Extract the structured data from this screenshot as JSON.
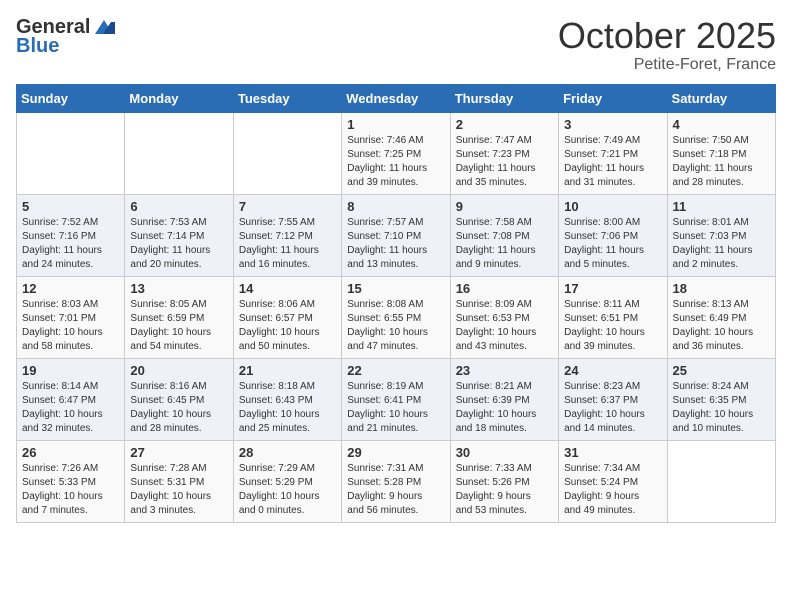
{
  "logo": {
    "general": "General",
    "blue": "Blue"
  },
  "title": "October 2025",
  "location": "Petite-Foret, France",
  "days_of_week": [
    "Sunday",
    "Monday",
    "Tuesday",
    "Wednesday",
    "Thursday",
    "Friday",
    "Saturday"
  ],
  "weeks": [
    [
      {
        "day": "",
        "content": ""
      },
      {
        "day": "",
        "content": ""
      },
      {
        "day": "",
        "content": ""
      },
      {
        "day": "1",
        "content": "Sunrise: 7:46 AM\nSunset: 7:25 PM\nDaylight: 11 hours\nand 39 minutes."
      },
      {
        "day": "2",
        "content": "Sunrise: 7:47 AM\nSunset: 7:23 PM\nDaylight: 11 hours\nand 35 minutes."
      },
      {
        "day": "3",
        "content": "Sunrise: 7:49 AM\nSunset: 7:21 PM\nDaylight: 11 hours\nand 31 minutes."
      },
      {
        "day": "4",
        "content": "Sunrise: 7:50 AM\nSunset: 7:18 PM\nDaylight: 11 hours\nand 28 minutes."
      }
    ],
    [
      {
        "day": "5",
        "content": "Sunrise: 7:52 AM\nSunset: 7:16 PM\nDaylight: 11 hours\nand 24 minutes."
      },
      {
        "day": "6",
        "content": "Sunrise: 7:53 AM\nSunset: 7:14 PM\nDaylight: 11 hours\nand 20 minutes."
      },
      {
        "day": "7",
        "content": "Sunrise: 7:55 AM\nSunset: 7:12 PM\nDaylight: 11 hours\nand 16 minutes."
      },
      {
        "day": "8",
        "content": "Sunrise: 7:57 AM\nSunset: 7:10 PM\nDaylight: 11 hours\nand 13 minutes."
      },
      {
        "day": "9",
        "content": "Sunrise: 7:58 AM\nSunset: 7:08 PM\nDaylight: 11 hours\nand 9 minutes."
      },
      {
        "day": "10",
        "content": "Sunrise: 8:00 AM\nSunset: 7:06 PM\nDaylight: 11 hours\nand 5 minutes."
      },
      {
        "day": "11",
        "content": "Sunrise: 8:01 AM\nSunset: 7:03 PM\nDaylight: 11 hours\nand 2 minutes."
      }
    ],
    [
      {
        "day": "12",
        "content": "Sunrise: 8:03 AM\nSunset: 7:01 PM\nDaylight: 10 hours\nand 58 minutes."
      },
      {
        "day": "13",
        "content": "Sunrise: 8:05 AM\nSunset: 6:59 PM\nDaylight: 10 hours\nand 54 minutes."
      },
      {
        "day": "14",
        "content": "Sunrise: 8:06 AM\nSunset: 6:57 PM\nDaylight: 10 hours\nand 50 minutes."
      },
      {
        "day": "15",
        "content": "Sunrise: 8:08 AM\nSunset: 6:55 PM\nDaylight: 10 hours\nand 47 minutes."
      },
      {
        "day": "16",
        "content": "Sunrise: 8:09 AM\nSunset: 6:53 PM\nDaylight: 10 hours\nand 43 minutes."
      },
      {
        "day": "17",
        "content": "Sunrise: 8:11 AM\nSunset: 6:51 PM\nDaylight: 10 hours\nand 39 minutes."
      },
      {
        "day": "18",
        "content": "Sunrise: 8:13 AM\nSunset: 6:49 PM\nDaylight: 10 hours\nand 36 minutes."
      }
    ],
    [
      {
        "day": "19",
        "content": "Sunrise: 8:14 AM\nSunset: 6:47 PM\nDaylight: 10 hours\nand 32 minutes."
      },
      {
        "day": "20",
        "content": "Sunrise: 8:16 AM\nSunset: 6:45 PM\nDaylight: 10 hours\nand 28 minutes."
      },
      {
        "day": "21",
        "content": "Sunrise: 8:18 AM\nSunset: 6:43 PM\nDaylight: 10 hours\nand 25 minutes."
      },
      {
        "day": "22",
        "content": "Sunrise: 8:19 AM\nSunset: 6:41 PM\nDaylight: 10 hours\nand 21 minutes."
      },
      {
        "day": "23",
        "content": "Sunrise: 8:21 AM\nSunset: 6:39 PM\nDaylight: 10 hours\nand 18 minutes."
      },
      {
        "day": "24",
        "content": "Sunrise: 8:23 AM\nSunset: 6:37 PM\nDaylight: 10 hours\nand 14 minutes."
      },
      {
        "day": "25",
        "content": "Sunrise: 8:24 AM\nSunset: 6:35 PM\nDaylight: 10 hours\nand 10 minutes."
      }
    ],
    [
      {
        "day": "26",
        "content": "Sunrise: 7:26 AM\nSunset: 5:33 PM\nDaylight: 10 hours\nand 7 minutes."
      },
      {
        "day": "27",
        "content": "Sunrise: 7:28 AM\nSunset: 5:31 PM\nDaylight: 10 hours\nand 3 minutes."
      },
      {
        "day": "28",
        "content": "Sunrise: 7:29 AM\nSunset: 5:29 PM\nDaylight: 10 hours\nand 0 minutes."
      },
      {
        "day": "29",
        "content": "Sunrise: 7:31 AM\nSunset: 5:28 PM\nDaylight: 9 hours\nand 56 minutes."
      },
      {
        "day": "30",
        "content": "Sunrise: 7:33 AM\nSunset: 5:26 PM\nDaylight: 9 hours\nand 53 minutes."
      },
      {
        "day": "31",
        "content": "Sunrise: 7:34 AM\nSunset: 5:24 PM\nDaylight: 9 hours\nand 49 minutes."
      },
      {
        "day": "",
        "content": ""
      }
    ]
  ]
}
